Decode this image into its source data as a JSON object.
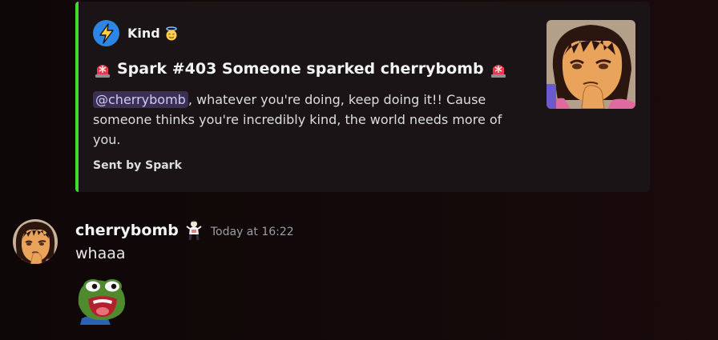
{
  "embed": {
    "author": {
      "name": "Kind",
      "icon": "lightning-bolt-icon",
      "badge_emoji": "smiling-face-with-halo-emoji"
    },
    "title": {
      "left_emoji": "police-light-emoji",
      "text": "Spark #403 Someone sparked cherrybomb",
      "right_emoji": "police-light-emoji"
    },
    "description": {
      "mention": "@cherrybomb",
      "text": ", whatever you're doing, keep doing it!! Cause someone thinks you're incredibly kind, the world needs more of you."
    },
    "footer": "Sent by Spark",
    "thumbnail": "cartoon-girl-thinking-image",
    "accent_color": "#3fdc2e"
  },
  "message": {
    "username": "cherrybomb",
    "role_icon": "figure-icon",
    "timestamp": "Today at 16:22",
    "text": "whaaa",
    "emoji": "shocked-frog-emoji",
    "avatar": "cartoon-girl-avatar"
  },
  "colors": {
    "mention_bg": "#3c2f52",
    "mention_text": "#c9cdfb",
    "timestamp": "#9b9ea6"
  }
}
